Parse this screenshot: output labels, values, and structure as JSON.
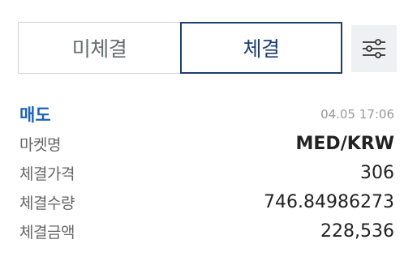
{
  "tabs": {
    "pending_label": "미체결",
    "filled_label": "체결"
  },
  "filter_button": {
    "icon": "sliders-icon"
  },
  "order": {
    "side": "매도",
    "timestamp": "04.05 17:06",
    "rows": [
      {
        "label": "마켓명",
        "value": "MED/KRW"
      },
      {
        "label": "체결가격",
        "value": "306"
      },
      {
        "label": "체결수량",
        "value": "746.84986273"
      },
      {
        "label": "체결금액",
        "value": "228,536"
      }
    ]
  },
  "colors": {
    "accent": "#1c3f70",
    "sell": "#1c63b8",
    "muted": "#999999"
  }
}
